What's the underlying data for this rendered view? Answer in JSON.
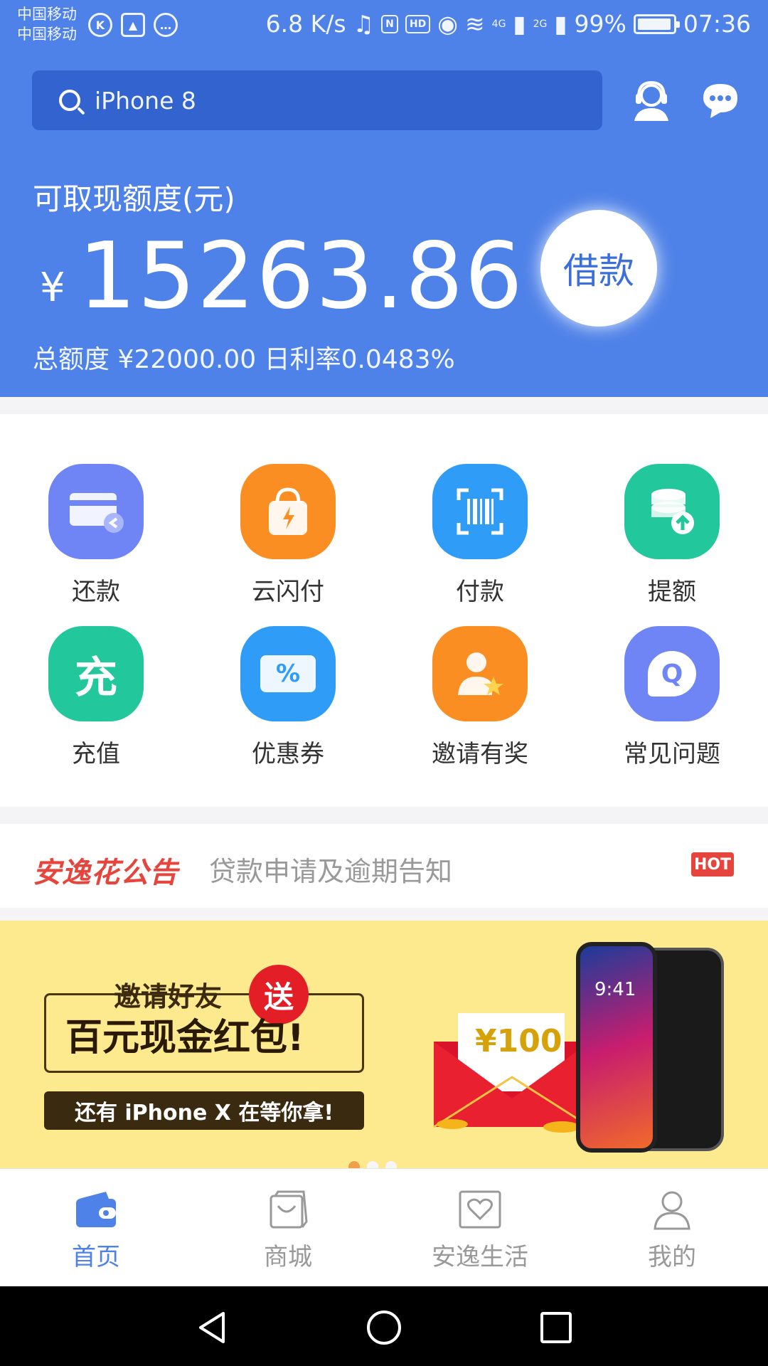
{
  "status_bar": {
    "carrier_1": "中国移动",
    "carrier_2": "中国移动",
    "speed": "6.8 K/s",
    "network_1": "4G",
    "network_2": "2G",
    "battery": "99%",
    "time": "07:36",
    "hd": "HD"
  },
  "header": {
    "search_placeholder": "iPhone 8"
  },
  "account": {
    "quota_label": "可取现额度(元)",
    "currency": "¥",
    "amount": "15263.86",
    "meta": "总额度 ¥22000.00  日利率0.0483%",
    "borrow_button": "借款"
  },
  "menu": [
    {
      "label": "还款",
      "icon": "repay-card-icon",
      "color": "#6f85f5"
    },
    {
      "label": "云闪付",
      "icon": "shopping-bag-icon",
      "color": "#fb8e22"
    },
    {
      "label": "付款",
      "icon": "barcode-scan-icon",
      "color": "#2f9cf7"
    },
    {
      "label": "提额",
      "icon": "coin-stack-up-icon",
      "color": "#22c79b"
    },
    {
      "label": "充值",
      "icon": "recharge-icon",
      "color": "#22c79b"
    },
    {
      "label": "优惠券",
      "icon": "coupon-icon",
      "color": "#2f9cf7"
    },
    {
      "label": "邀请有奖",
      "icon": "invite-user-star-icon",
      "color": "#fb8e22"
    },
    {
      "label": "常见问题",
      "icon": "faq-bubble-icon",
      "color": "#6f85f5"
    }
  ],
  "menu_icon_text": {
    "recharge": "充",
    "coupon": "%",
    "faq": "Q"
  },
  "notice": {
    "brand": "安逸花公告",
    "text": "贷款申请及逾期告知",
    "badge": "HOT"
  },
  "banner": {
    "title": "邀请好友",
    "tag": "送",
    "main": "百元现金红包!",
    "strip": "还有 iPhone X 在等你拿!",
    "envelope_amount": "¥100",
    "phone_time": "9:41"
  },
  "tabs": [
    {
      "label": "首页",
      "active": true
    },
    {
      "label": "商城",
      "active": false
    },
    {
      "label": "安逸生活",
      "active": false
    },
    {
      "label": "我的",
      "active": false
    }
  ]
}
